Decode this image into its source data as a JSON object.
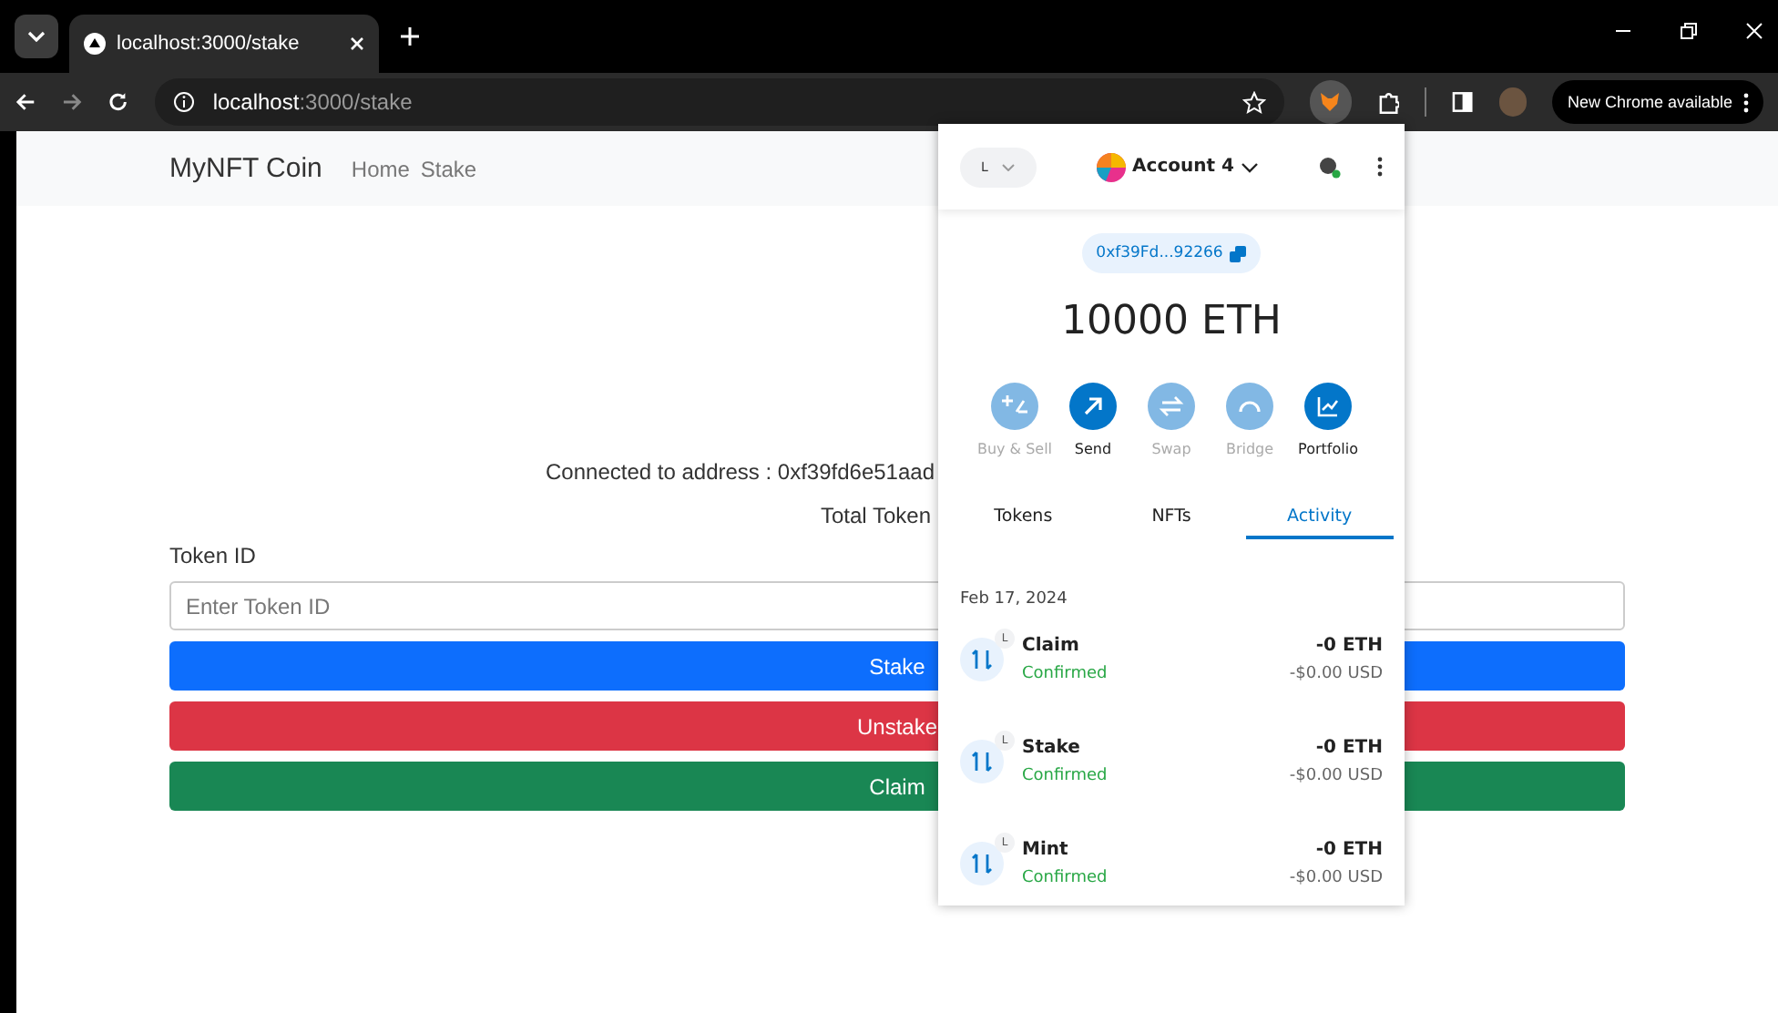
{
  "browser": {
    "tabs": [
      {
        "title": "localhost:3000/stake",
        "selected": true
      }
    ],
    "address": {
      "host": "localhost",
      "path": ":3000/stake"
    },
    "update_button": "New Chrome available"
  },
  "page": {
    "brand": "MyNFT Coin",
    "nav": [
      {
        "label": "Home"
      },
      {
        "label": "Stake"
      }
    ],
    "connected_text": "Connected to address : 0xf39fd6e51aad",
    "total_text": "Total Token",
    "token_label": "Token ID",
    "token_placeholder": "Enter Token ID",
    "buttons": [
      {
        "label": "Stake",
        "kind": "primary"
      },
      {
        "label": "Unstake",
        "kind": "danger"
      },
      {
        "label": "Claim",
        "kind": "success"
      }
    ]
  },
  "wallet": {
    "network": "L",
    "account": "Account 4",
    "address": "0xf39Fd...92266",
    "balance": "10000 ETH",
    "actions": [
      {
        "label": "Buy & Sell",
        "kind": "buy",
        "disabled": true
      },
      {
        "label": "Send",
        "kind": "send",
        "disabled": false
      },
      {
        "label": "Swap",
        "kind": "swap",
        "disabled": true
      },
      {
        "label": "Bridge",
        "kind": "bridge",
        "disabled": true
      },
      {
        "label": "Portfolio",
        "kind": "portfolio",
        "disabled": false
      }
    ],
    "tabs": [
      {
        "label": "Tokens",
        "selected": false
      },
      {
        "label": "NFTs",
        "selected": false
      },
      {
        "label": "Activity",
        "selected": true
      }
    ],
    "date": "Feb 17, 2024",
    "transactions": [
      {
        "badge": "L",
        "title": "Claim",
        "status": "Confirmed",
        "amount": "-0 ETH",
        "fiat": "-$0.00 USD"
      },
      {
        "badge": "L",
        "title": "Stake",
        "status": "Confirmed",
        "amount": "-0 ETH",
        "fiat": "-$0.00 USD"
      },
      {
        "badge": "L",
        "title": "Mint",
        "status": "Confirmed",
        "amount": "-0 ETH",
        "fiat": "-$0.00 USD"
      }
    ]
  }
}
